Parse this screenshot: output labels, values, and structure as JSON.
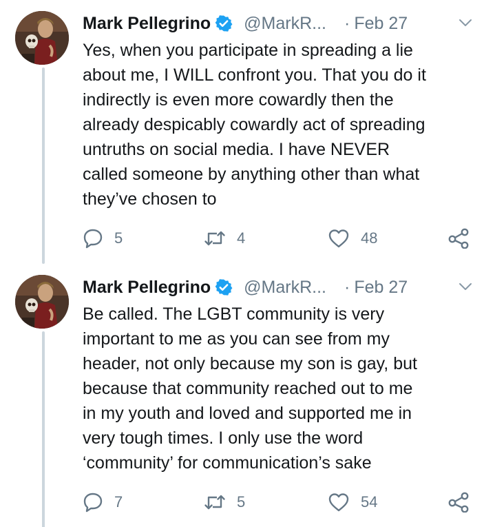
{
  "tweets": [
    {
      "author_name": "Mark Pellegrino",
      "handle": "@MarkR...",
      "separator": "·",
      "date": "Feb 27",
      "text": "Yes, when you participate in spreading a lie\nabout me, I WILL confront you. That you do it\nindirectly is even more cowardly then the\nalready despicably cowardly act of spreading\nuntruths on social media. I have NEVER\ncalled someone by anything other than what\nthey’ve chosen to",
      "replies": "5",
      "retweets": "4",
      "likes": "48"
    },
    {
      "author_name": "Mark Pellegrino",
      "handle": "@MarkR...",
      "separator": "·",
      "date": "Feb 27",
      "text": "Be called. The LGBT community is very\nimportant to me as you can see from my\nheader, not only because my son is gay, but\nbecause that community reached out to me\nin my youth and loved and supported me in\nvery tough times. I only use the word\n‘community’ for communication’s sake",
      "replies": "7",
      "retweets": "5",
      "likes": "54"
    }
  ],
  "colors": {
    "text": "#14171a",
    "secondary": "#657786",
    "verified": "#1da1f2",
    "thread_line": "#ccd6dd"
  },
  "icons": {
    "reply": "speech-bubble-icon",
    "retweet": "retweet-arrows-icon",
    "like": "heart-icon",
    "share": "share-nodes-icon",
    "menu": "chevron-down-icon",
    "verified": "verified-badge-icon"
  }
}
